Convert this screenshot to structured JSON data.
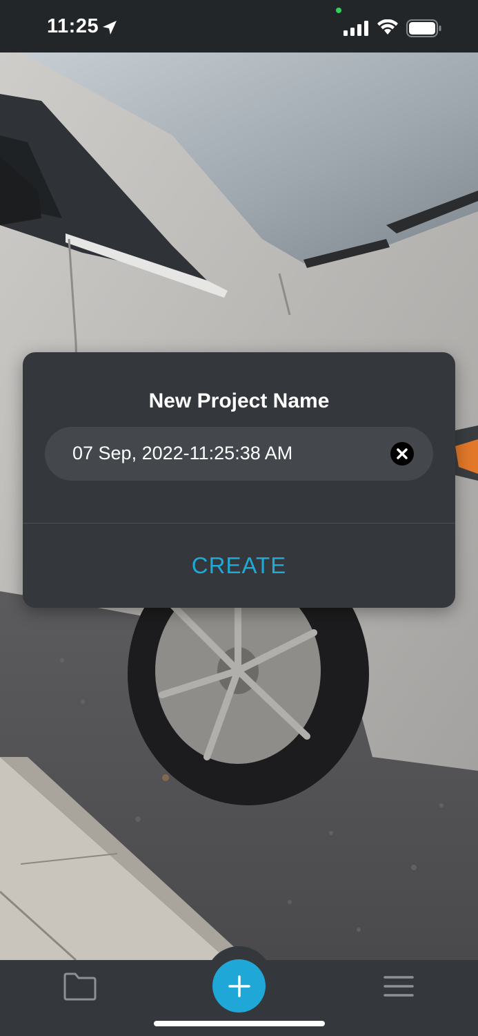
{
  "status_bar": {
    "time": "11:25",
    "icons": [
      "location-arrow-icon",
      "cellular-signal-icon",
      "wifi-icon",
      "battery-icon"
    ]
  },
  "background": {
    "description_icon": "camera-viewfinder-image"
  },
  "dialog": {
    "title": "New Project Name",
    "field_value": "07 Sep, 2022-11:25:38 AM",
    "clear_icon": "clear-x-icon",
    "create_label": "CREATE"
  },
  "tab_bar": {
    "left_icon": "folder-icon",
    "center_icon": "plus-icon",
    "right_icon": "hamburger-menu-icon"
  },
  "colors": {
    "accent": "#1EA7D7",
    "dialog_bg": "#34383D",
    "field_bg": "#44484D",
    "create_text": "#1FA9D6"
  }
}
